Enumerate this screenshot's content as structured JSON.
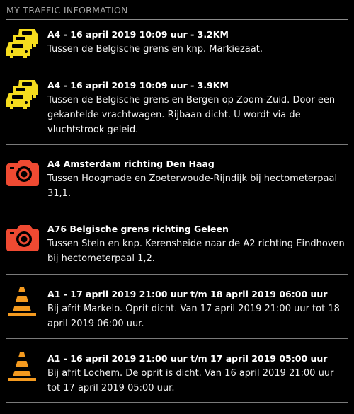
{
  "header": {
    "title": "MY TRAFFIC INFORMATION"
  },
  "colors": {
    "jam_icon": "#f5dc1e",
    "camera_icon": "#ef4a32",
    "roadworks_icon": "#f49a1f",
    "background": "#000000"
  },
  "items": [
    {
      "icon": "traffic-jam-icon",
      "title": "A4 - 16 april 2019 10:09 uur - 3.2KM",
      "description": "Tussen de Belgische grens en knp. Markiezaat."
    },
    {
      "icon": "traffic-jam-icon",
      "title": "A4 - 16 april 2019 10:09 uur - 3.9KM",
      "description": "Tussen de Belgische grens en Bergen op Zoom-Zuid. Door een gekantelde vrachtwagen. Rijbaan dicht. U wordt via de vluchtstrook geleid."
    },
    {
      "icon": "speed-camera-icon",
      "title": "A4 Amsterdam richting Den Haag",
      "description": "Tussen Hoogmade en Zoeterwoude-Rijndijk bij hectometerpaal 31,1."
    },
    {
      "icon": "speed-camera-icon",
      "title": "A76 Belgische grens richting Geleen",
      "description": "Tussen Stein en knp. Kerensheide naar de A2 richting Eindhoven bij hectometerpaal 1,2."
    },
    {
      "icon": "roadworks-cone-icon",
      "title": "A1 - 17 april 2019 21:00 uur t/m 18 april 2019 06:00 uur",
      "description": "Bij afrit Markelo. Oprit dicht. Van 17 april 2019 21:00 uur tot 18 april 2019 06:00 uur."
    },
    {
      "icon": "roadworks-cone-icon",
      "title": "A1 - 16 april 2019 21:00 uur t/m 17 april 2019 05:00 uur",
      "description": "Bij afrit Lochem. De oprit is dicht. Van 16 april 2019 21:00 uur tot 17 april 2019 05:00 uur."
    }
  ]
}
